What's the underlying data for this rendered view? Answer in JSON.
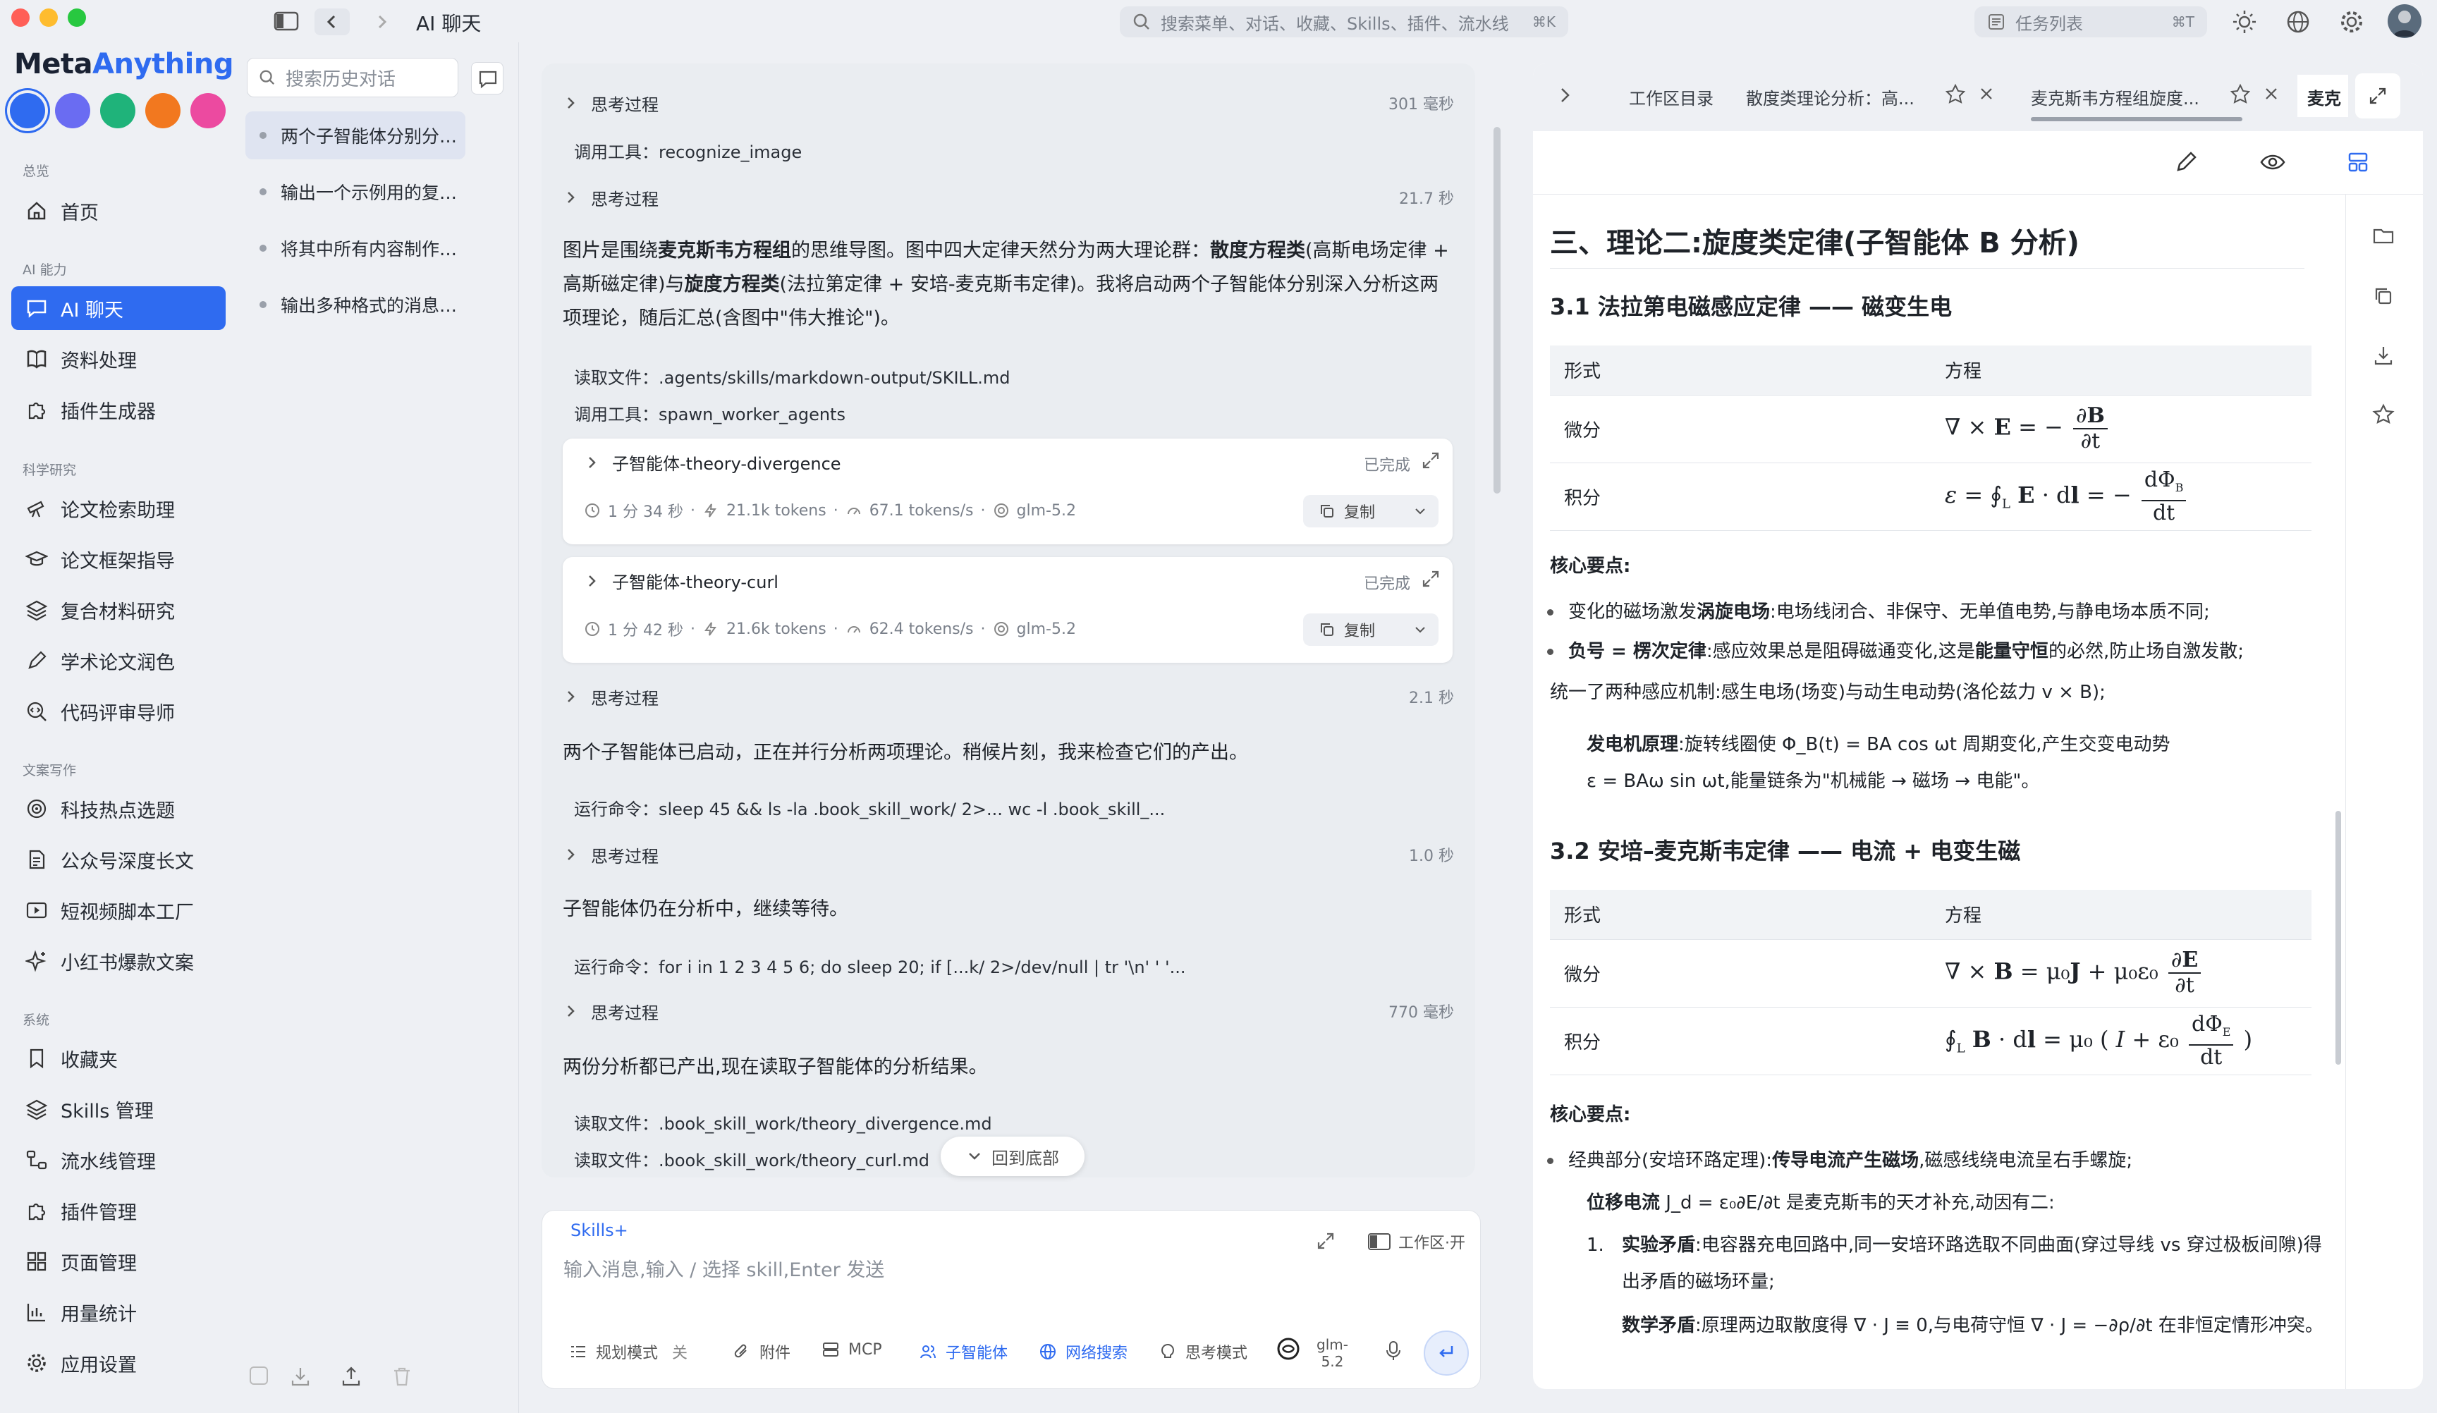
{
  "titlebar": {
    "window_title": "AI 聊天",
    "search_placeholder": "搜索菜单、对话、收藏、Skills、插件、流水线",
    "search_shortcut": "⌘K",
    "tasklist_label": "任务列表",
    "tasklist_shortcut": "⌘T"
  },
  "brand": {
    "part1": "Meta",
    "part2": "Anything"
  },
  "theme_colors": [
    "#2f6bf0",
    "#6a6cf2",
    "#1fb37a",
    "#f2781f",
    "#ec4aa0"
  ],
  "sidebar": {
    "sections": {
      "overview": "总览",
      "ai": "AI 能力",
      "science": "科学研究",
      "writing": "文案写作",
      "system": "系统"
    },
    "items": [
      {
        "label": "首页",
        "icon": "home-icon"
      },
      {
        "label": "AI 聊天",
        "icon": "chat-icon"
      },
      {
        "label": "资料处理",
        "icon": "book-icon"
      },
      {
        "label": "插件生成器",
        "icon": "puzzle-icon"
      },
      {
        "label": "论文检索助理",
        "icon": "telescope-icon"
      },
      {
        "label": "论文框架指导",
        "icon": "graduation-icon"
      },
      {
        "label": "复合材料研究",
        "icon": "layers-icon"
      },
      {
        "label": "学术论文润色",
        "icon": "pen-icon"
      },
      {
        "label": "代码评审导师",
        "icon": "search-code-icon"
      },
      {
        "label": "科技热点选题",
        "icon": "target-icon"
      },
      {
        "label": "公众号深度长文",
        "icon": "document-icon"
      },
      {
        "label": "短视频脚本工厂",
        "icon": "video-icon"
      },
      {
        "label": "小红书爆款文案",
        "icon": "sparkle-icon"
      },
      {
        "label": "收藏夹",
        "icon": "bookmark-icon"
      },
      {
        "label": "Skills 管理",
        "icon": "layers-icon"
      },
      {
        "label": "流水线管理",
        "icon": "flow-icon"
      },
      {
        "label": "插件管理",
        "icon": "puzzle-icon"
      },
      {
        "label": "页面管理",
        "icon": "grid-icon"
      },
      {
        "label": "用量统计",
        "icon": "chart-icon"
      },
      {
        "label": "应用设置",
        "icon": "gear-icon"
      }
    ]
  },
  "history": {
    "search_placeholder": "搜索历史对话",
    "items": [
      "两个子智能体分别分析如...",
      "输出一个示例用的复杂公...",
      "将其中所有内容制作一份...",
      "输出多种格式的消息，比..."
    ]
  },
  "chat": {
    "think_label": "思考过程",
    "thinks": [
      "301 毫秒",
      "21.7 秒",
      "2.1 秒",
      "1.0 秒",
      "770 毫秒"
    ],
    "tool1": "调用工具：recognize_image",
    "para1_a": "图片是围绕",
    "para1_b": "麦克斯韦方程组",
    "para1_c": "的思维导图。图中四大定律天然分为两大理论群：",
    "para1_d": "散度方程类",
    "para1_e": "(高斯电场定律 + 高斯磁定律)与",
    "para1_f": "旋度方程类",
    "para1_g": "(法拉第定律 + 安培-麦克斯韦定律)。我将启动两个子智能体分别深入分析这两项理论，随后汇总(含图中\"伟大推论\")。",
    "read1": "读取文件：.agents/skills/markdown-output/SKILL.md",
    "tool2": "调用工具：spawn_worker_agents",
    "agents": [
      {
        "name": "子智能体-theory-divergence",
        "status": "已完成",
        "time": "1 分 34 秒",
        "tokens": "21.1k tokens",
        "speed": "67.1 tokens/s",
        "model": "glm-5.2",
        "copy": "复制"
      },
      {
        "name": "子智能体-theory-curl",
        "status": "已完成",
        "time": "1 分 42 秒",
        "tokens": "21.6k tokens",
        "speed": "62.4 tokens/s",
        "model": "glm-5.2",
        "copy": "复制"
      }
    ],
    "para2": "两个子智能体已启动，正在并行分析两项理论。稍候片刻，我来检查它们的产出。",
    "cmd1": "运行命令：sleep 45 && ls -la .book_skill_work/ 2>... wc -l .book_skill_...",
    "para3": "子智能体仍在分析中，继续等待。",
    "cmd2": "运行命令：for i in 1 2 3 4 5 6; do sleep 20; if [...k/ 2>/dev/null | tr '\\n' ' '...",
    "para4": "两份分析都已产出,现在读取子智能体的分析结果。",
    "read2": "读取文件：.book_skill_work/theory_divergence.md",
    "read3": "读取文件：.book_skill_work/theory_curl.md",
    "back_bottom": "回到底部"
  },
  "composer": {
    "skills_label": "Skills+",
    "placeholder": "输入消息,输入 / 选择 skill,Enter 发送",
    "workspace_toggle": "工作区·开",
    "buttons": {
      "plan": "规划模式",
      "plan_state": "关",
      "attach": "附件",
      "mcp": "MCP",
      "agent": "子智能体",
      "web": "网络搜索",
      "think": "思考模式",
      "model_line1": "glm-",
      "model_line2": "5.2"
    }
  },
  "rpanel": {
    "tabs": [
      "工作区目录",
      "散度类理论分析：高...",
      "麦克斯韦方程组旋度...",
      "麦克"
    ],
    "h2": "三、理论二:旋度类定律(子智能体 B 分析)",
    "s31": "3.1 法拉第电磁感应定律 —— 磁变生电",
    "s32": "3.2 安培–麦克斯韦定律 —— 电流 + 电变生磁",
    "col_form": "形式",
    "col_eq": "方程",
    "row_diff": "微分",
    "row_int": "积分",
    "key_points": "核心要点:",
    "f_b1_pre": "变化的磁场激发",
    "f_b1_bold": "涡旋电场",
    "f_b1_post": ":电场线闭合、非保守、无单值电势,与静电场本质不同;",
    "f_b2_bold1": "负号 = 楞次定律",
    "f_b2_mid": ":感应效果总是阻碍磁通变化,这是",
    "f_b2_bold2": "能量守恒",
    "f_b2_post": "的必然,防止场自激发散;",
    "f_b3": "统一了两种感应机制:感生电场(场变)与动生电动势(洛伦兹力 v × B);",
    "f_gen_bold": "发电机原理",
    "f_gen_1": ":旋转线圈使 Φ_B(t) = BA cos ωt 周期变化,产生交变电动势",
    "f_gen_2": "ε = BAω sin ωt,能量链条为\"机械能 → 磁场 → 电能\"。",
    "a_b1_pre": "经典部分(安培环路定理):",
    "a_b1_bold": "传导电流产生磁场",
    "a_b1_post": ",磁感线绕电流呈右手螺旋;",
    "a_disp_bold": "位移电流",
    "a_disp_post": " J_d = ε₀∂E/∂t 是麦克斯韦的天才补充,动因有二:",
    "a_n1_num": "1.",
    "a_n1_bold": "实验矛盾",
    "a_n1_post": ":电容器充电回路中,同一安培环路选取不同曲面(穿过导线 vs 穿过极板间隙)得出矛盾的磁场环量;",
    "a_n2_bold": "数学矛盾",
    "a_n2_post": ":原理两边取散度得 ∇ · J ≡ 0,与电荷守恒 ∇ · J = −∂ρ/∂t 在非恒定情形冲突。"
  }
}
